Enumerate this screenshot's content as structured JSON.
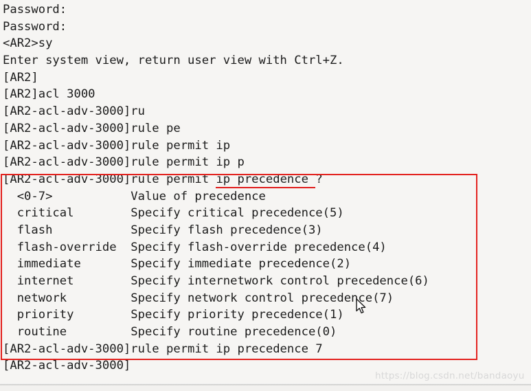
{
  "terminal": {
    "device_prompt_user": "<AR2>",
    "device_prompt_system": "[AR2]",
    "device_prompt_acl": "[AR2-acl-adv-3000]",
    "lines": [
      {
        "text": "Password:"
      },
      {
        "text": "Password:"
      },
      {
        "text": "<AR2>sy"
      },
      {
        "text": "Enter system view, return user view with Ctrl+Z."
      },
      {
        "text": "[AR2]"
      },
      {
        "text": "[AR2]acl 3000"
      },
      {
        "text": "[AR2-acl-adv-3000]ru"
      },
      {
        "text": "[AR2-acl-adv-3000]rule pe"
      },
      {
        "text": "[AR2-acl-adv-3000]rule permit ip"
      },
      {
        "text": "[AR2-acl-adv-3000]rule permit ip p"
      },
      {
        "text": "[AR2-acl-adv-3000]rule permit ",
        "underline": "ip precedence ",
        "tail": "?"
      },
      {
        "text": "  <0-7>           Value of precedence"
      },
      {
        "text": "  critical        Specify critical precedence(5)"
      },
      {
        "text": "  flash           Specify flash precedence(3)"
      },
      {
        "text": "  flash-override  Specify flash-override precedence(4)"
      },
      {
        "text": "  immediate       Specify immediate precedence(2)"
      },
      {
        "text": "  internet        Specify internetwork control precedence(6)"
      },
      {
        "text": "  network         Specify network control precedence(7)"
      },
      {
        "text": "  priority        Specify priority precedence(1)"
      },
      {
        "text": "  routine         Specify routine precedence(0)"
      },
      {
        "text": "[AR2-acl-adv-3000]rule permit ip precedence 7"
      },
      {
        "text": "[AR2-acl-adv-3000]"
      }
    ],
    "help_options": [
      {
        "keyword": "<0-7>",
        "description": "Value of precedence"
      },
      {
        "keyword": "critical",
        "description": "Specify critical precedence(5)"
      },
      {
        "keyword": "flash",
        "description": "Specify flash precedence(3)"
      },
      {
        "keyword": "flash-override",
        "description": "Specify flash-override precedence(4)"
      },
      {
        "keyword": "immediate",
        "description": "Specify immediate precedence(2)"
      },
      {
        "keyword": "internet",
        "description": "Specify internetwork control precedence(6)"
      },
      {
        "keyword": "network",
        "description": "Specify network control precedence(7)"
      },
      {
        "keyword": "priority",
        "description": "Specify priority precedence(1)"
      },
      {
        "keyword": "routine",
        "description": "Specify routine precedence(0)"
      }
    ]
  },
  "annotations": {
    "highlight_box_color": "#e3211d",
    "underline_color": "#e01b1b",
    "underlined_text": "ip precedence "
  },
  "watermark": {
    "text": "https://blog.csdn.net/bandaoyu",
    "color": "#d8d8d8"
  },
  "cursor": {
    "icon": "mouse-pointer-icon"
  }
}
